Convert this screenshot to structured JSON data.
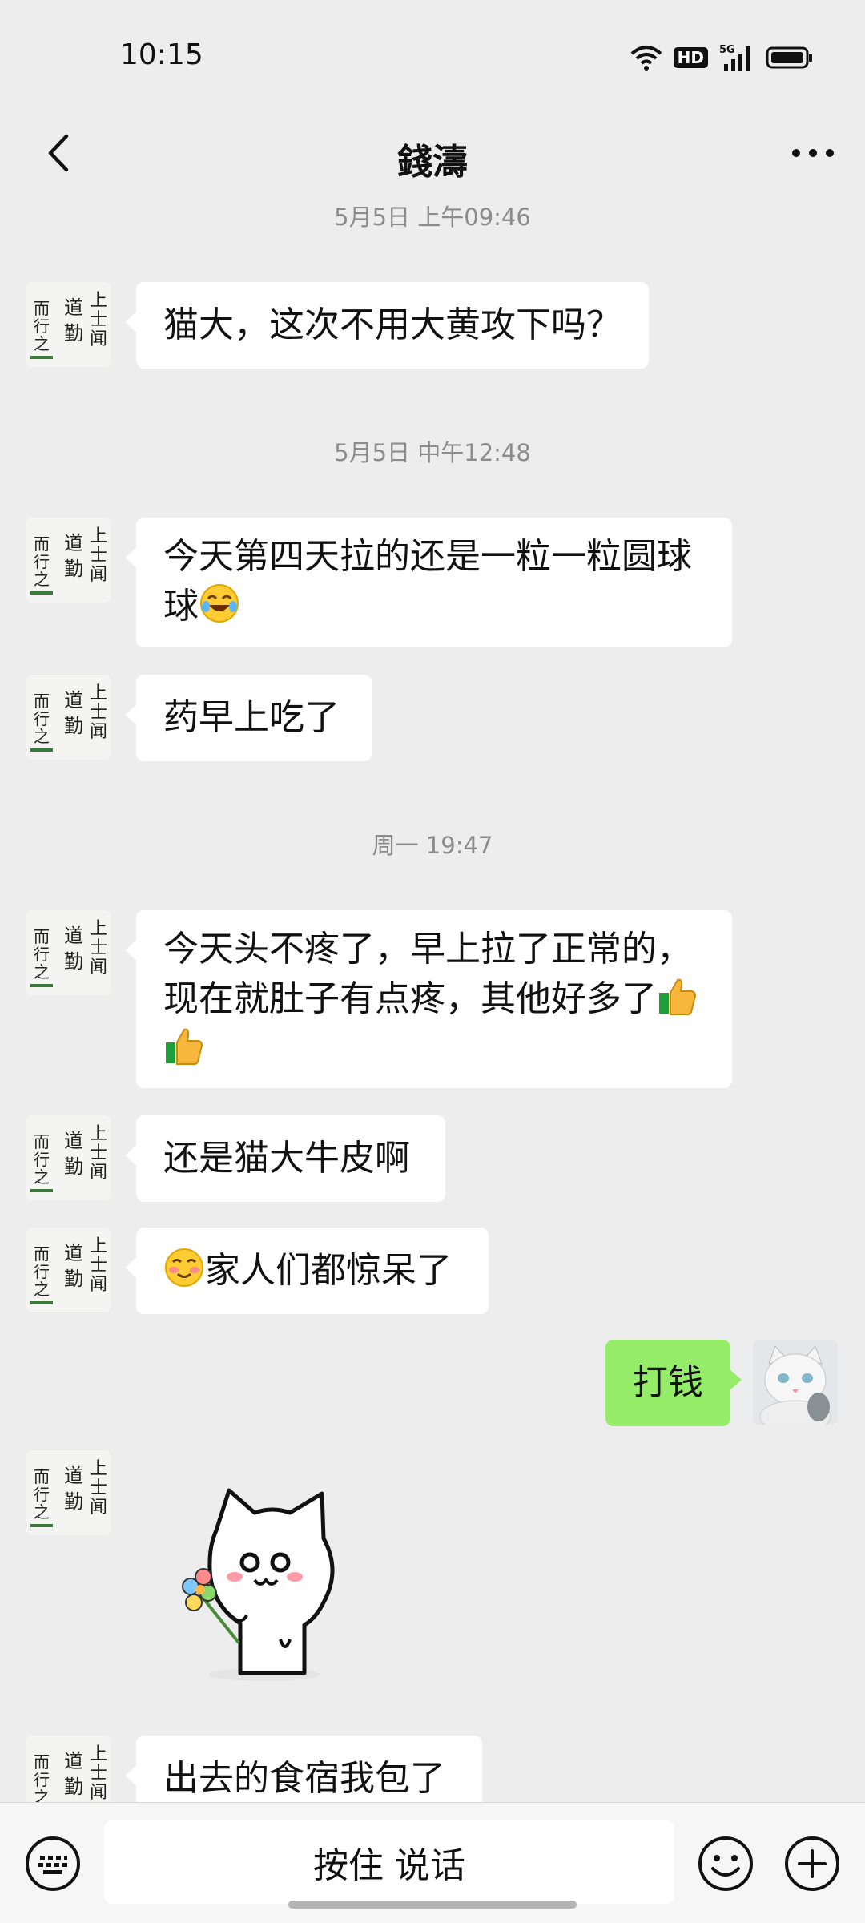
{
  "status_bar": {
    "time": "10:15",
    "hd_label": "HD",
    "network": "5G"
  },
  "header": {
    "title": "錢濤"
  },
  "chat": {
    "timestamps": [
      "5月5日 上午09:46",
      "5月5日 中午12:48",
      "周一 19:47"
    ],
    "messages": [
      {
        "sender": "other",
        "text": "猫大，这次不用大黄攻下吗？"
      },
      {
        "sender": "other",
        "text": "今天第四天拉的还是一粒一粒圆球球",
        "emoji": "laughing-tears-emoji"
      },
      {
        "sender": "other",
        "text": "药早上吃了"
      },
      {
        "sender": "other",
        "line1": "今天头不疼了，早上拉了正常的，",
        "line2": "现在就肚子有点疼，其他好多了",
        "emoji": "thumbs-up-emoji"
      },
      {
        "sender": "other",
        "text": "还是猫大牛皮啊"
      },
      {
        "sender": "other",
        "text": "家人们都惊呆了",
        "emoji": "flushed-smile-emoji"
      },
      {
        "sender": "me",
        "text": "打钱"
      },
      {
        "sender": "other",
        "type": "sticker",
        "sticker": "cat-with-flower-sticker"
      },
      {
        "sender": "other",
        "text": "出去的食宿我包了"
      }
    ]
  },
  "avatar": {
    "text": "上士闻道 勤而行之"
  },
  "input_bar": {
    "hold_to_talk": "按住 说话"
  },
  "colors": {
    "background": "#ededed",
    "my_bubble": "#95ec69",
    "other_bubble": "#ffffff"
  }
}
